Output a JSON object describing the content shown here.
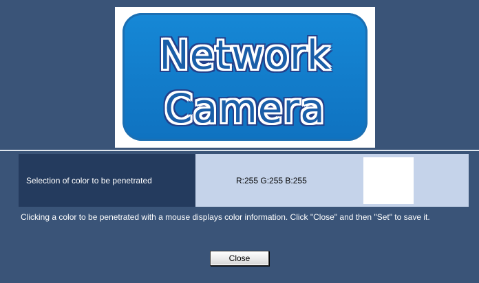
{
  "logo": {
    "line1": "Network",
    "line2": "Camera"
  },
  "color_setting": {
    "label": "Selection of color to be penetrated",
    "rgb_readout": "R:255 G:255 B:255",
    "swatch_color": "#ffffff"
  },
  "help": {
    "text": "Clicking a color to be penetrated with a mouse displays color information. Click \"Close\" and then \"Set\" to save it."
  },
  "buttons": {
    "close_label": "Close"
  }
}
